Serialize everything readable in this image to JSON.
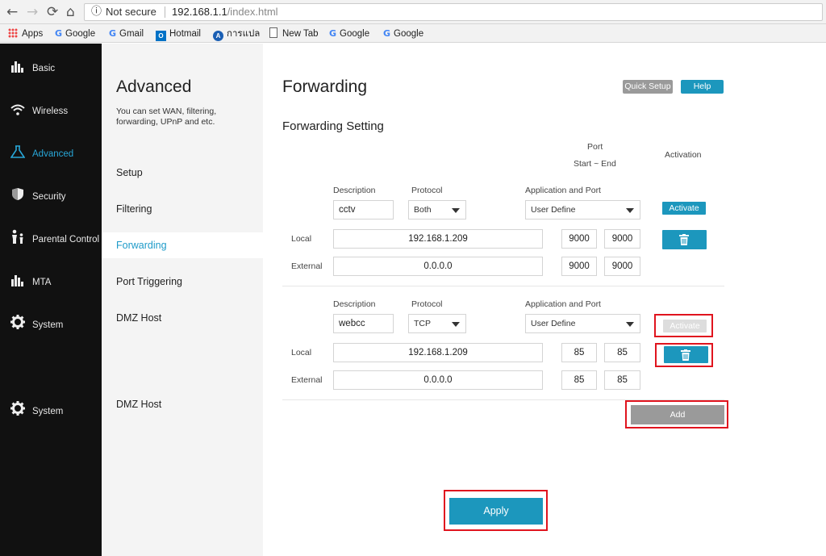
{
  "browser": {
    "back_glyph": "←",
    "forward_glyph": "→",
    "reload_glyph": "⟳",
    "home_glyph": "⌂",
    "security_label": "Not secure",
    "url_host": "192.168.1.1",
    "url_path": "/index.html",
    "bookmarks": [
      "Apps",
      "Google",
      "Gmail",
      "Hotmail",
      "การแปล",
      "New Tab",
      "Google",
      "Google"
    ]
  },
  "sidebar": {
    "items": [
      {
        "label": "Basic",
        "icon": "bar-chart-icon"
      },
      {
        "label": "Wireless",
        "icon": "wifi-icon"
      },
      {
        "label": "Advanced",
        "icon": "flask-icon"
      },
      {
        "label": "Security",
        "icon": "shield-icon"
      },
      {
        "label": "Parental Control",
        "icon": "family-icon"
      },
      {
        "label": "MTA",
        "icon": "bar-chart-icon"
      },
      {
        "label": "System",
        "icon": "gear-icon"
      },
      {
        "label": "System",
        "icon": "gear-icon"
      }
    ],
    "active": "Advanced",
    "accent": "#28a7d8"
  },
  "subnav": {
    "title": "Advanced",
    "description": "You can set WAN, filtering, forwarding, UPnP and etc.",
    "items": [
      "Setup",
      "Filtering",
      "Forwarding",
      "Port Triggering",
      "DMZ Host",
      "DMZ Host"
    ],
    "active": "Forwarding"
  },
  "main": {
    "title": "Forwarding",
    "quick_setup_label": "Quick Setup",
    "help_label": "Help",
    "section_title": "Forwarding Setting",
    "port_header": "Port",
    "port_range_header": "Start ~ End",
    "activation_header": "Activation",
    "labels": {
      "description": "Description",
      "protocol": "Protocol",
      "app_port": "Application and Port",
      "local": "Local",
      "external": "External"
    },
    "rules": [
      {
        "description": "cctv",
        "protocol": "Both",
        "application": "User Define",
        "local_ip": "192.168.1.209",
        "local_start": "9000",
        "local_end": "9000",
        "external_ip": "0.0.0.0",
        "external_start": "9000",
        "external_end": "9000",
        "activate_label": "Activate",
        "active": true
      },
      {
        "description": "webcc",
        "protocol": "TCP",
        "application": "User Define",
        "local_ip": "192.168.1.209",
        "local_start": "85",
        "local_end": "85",
        "external_ip": "0.0.0.0",
        "external_start": "85",
        "external_end": "85",
        "activate_label": "Activate",
        "active": false
      }
    ],
    "add_label": "Add",
    "apply_label": "Apply",
    "accent": "#1c97bd",
    "highlight_color": "#e0141e"
  }
}
